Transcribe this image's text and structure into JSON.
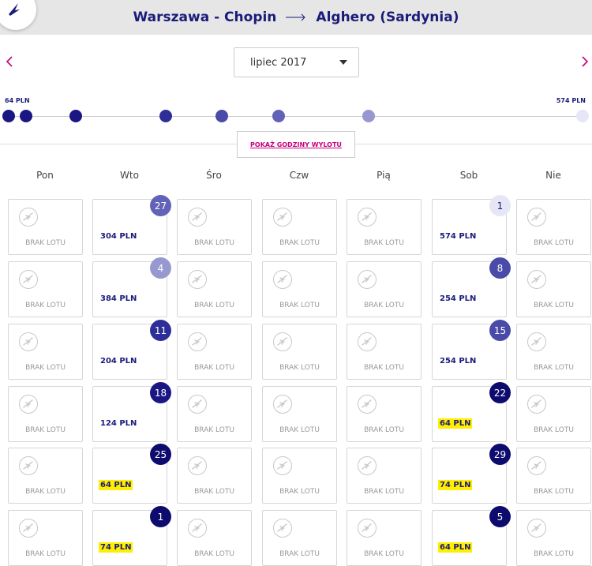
{
  "header": {
    "origin": "Warszawa - Chopin",
    "destination": "Alghero (Sardynia)"
  },
  "navigation": {
    "prev_icon": "chevron-left-icon",
    "next_icon": "chevron-right-icon",
    "month_value": "lipiec 2017"
  },
  "price_scale": {
    "min_label": "64 PLN",
    "max_label": "574 PLN",
    "dots": [
      {
        "price": 64,
        "color": "#1a1785"
      },
      {
        "price": 74,
        "color": "#1a1785"
      },
      {
        "price": 124,
        "color": "#1a1785"
      },
      {
        "price": 204,
        "color": "#2e2e99"
      },
      {
        "price": 254,
        "color": "#4a4aa8"
      },
      {
        "price": 304,
        "color": "#6262b8"
      },
      {
        "price": 384,
        "color": "#9898d0"
      },
      {
        "price": 574,
        "color": "#e6e6f6"
      }
    ]
  },
  "show_times_label": "POKAŻ GODZINY WYLOTU",
  "weekdays": [
    "Pon",
    "Wto",
    "Śro",
    "Czw",
    "Pią",
    "Sob",
    "Nie"
  ],
  "no_flight_label": "BRAK LOTU",
  "flights": [
    {
      "row": 0,
      "col": 1,
      "day": "27",
      "price": "304 PLN",
      "highlight": false,
      "color": "#6262b8"
    },
    {
      "row": 0,
      "col": 5,
      "day": "1",
      "price": "574 PLN",
      "highlight": false,
      "color": "#e6e6f6",
      "text_color": "#1a1c7a"
    },
    {
      "row": 1,
      "col": 1,
      "day": "4",
      "price": "384 PLN",
      "highlight": false,
      "color": "#9898d0"
    },
    {
      "row": 1,
      "col": 5,
      "day": "8",
      "price": "254 PLN",
      "highlight": false,
      "color": "#4a4aa8"
    },
    {
      "row": 2,
      "col": 1,
      "day": "11",
      "price": "204 PLN",
      "highlight": false,
      "color": "#2e2e99"
    },
    {
      "row": 2,
      "col": 5,
      "day": "15",
      "price": "254 PLN",
      "highlight": false,
      "color": "#4a4aa8"
    },
    {
      "row": 3,
      "col": 1,
      "day": "18",
      "price": "124 PLN",
      "highlight": false,
      "color": "#1a1785"
    },
    {
      "row": 3,
      "col": 5,
      "day": "22",
      "price": "64 PLN",
      "highlight": true,
      "color": "#0d0b6e"
    },
    {
      "row": 4,
      "col": 1,
      "day": "25",
      "price": "64 PLN",
      "highlight": true,
      "color": "#0d0b6e"
    },
    {
      "row": 4,
      "col": 5,
      "day": "29",
      "price": "74 PLN",
      "highlight": true,
      "color": "#0d0b6e"
    },
    {
      "row": 5,
      "col": 1,
      "day": "1",
      "price": "74 PLN",
      "highlight": true,
      "color": "#0d0b6e"
    },
    {
      "row": 5,
      "col": 5,
      "day": "5",
      "price": "64 PLN",
      "highlight": true,
      "color": "#0d0b6e"
    }
  ]
}
